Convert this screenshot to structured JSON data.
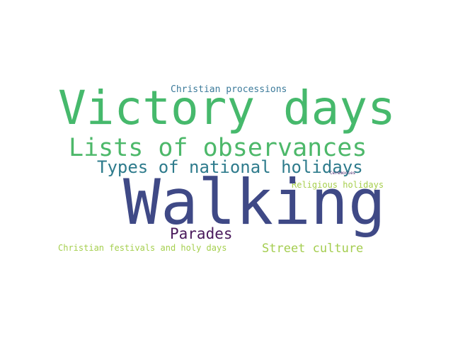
{
  "word_cloud": {
    "words": [
      {
        "text": "Christian processions",
        "color": "#3b7a9a"
      },
      {
        "text": "Victory days",
        "color": "#46b96c"
      },
      {
        "text": "Lists of observances",
        "color": "#4db86a"
      },
      {
        "text": "Types of national holidays",
        "color": "#2e7b8c"
      },
      {
        "text": "Ceremonies",
        "color": "#4b2a6e"
      },
      {
        "text": "Religious holidays",
        "color": "#a7cf4d"
      },
      {
        "text": "Walking",
        "color": "#3f4986"
      },
      {
        "text": "Parades",
        "color": "#4a1a5c"
      },
      {
        "text": "Christian festivals and holy days",
        "color": "#a5cf4e"
      },
      {
        "text": "Street culture",
        "color": "#a4cd4f"
      }
    ]
  }
}
